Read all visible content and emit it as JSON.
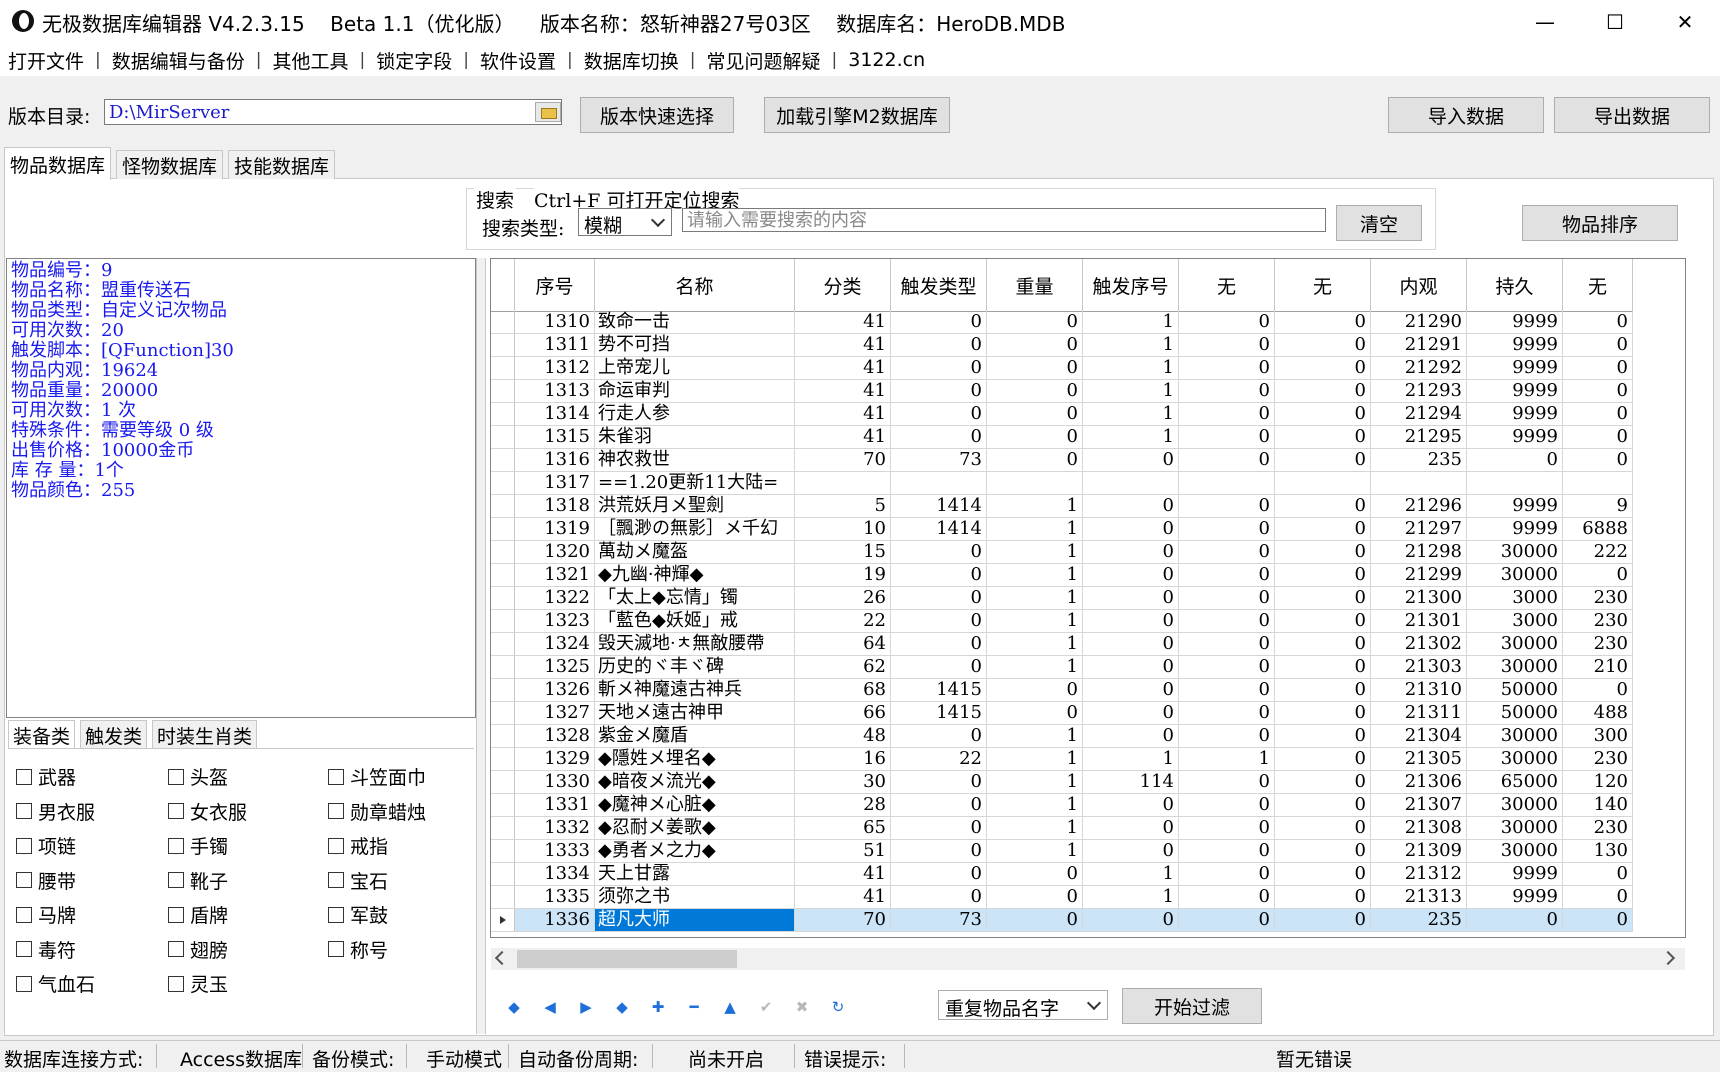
{
  "window": {
    "title": "无极数据库编辑器 V4.2.3.15    Beta 1.1（优化版）    版本名称：怒斩神器27号03区    数据库名：HeroDB.MDB",
    "minimize": "—",
    "maximize": "☐",
    "close": "✕"
  },
  "menu": [
    "打开文件",
    "数据编辑与备份",
    "其他工具",
    "锁定字段",
    "软件设置",
    "数据库切换",
    "常见问题解疑",
    "3122.cn"
  ],
  "menu_sep": "|",
  "toolbar": {
    "dir_label": "版本目录:",
    "dir_value": "D:\\MirServer",
    "quick_select": "版本快速选择",
    "load_m2": "加载引擎M2数据库",
    "import": "导入数据",
    "export": "导出数据"
  },
  "tabs": [
    "物品数据库",
    "怪物数据库",
    "技能数据库"
  ],
  "search": {
    "title": "搜索",
    "hint": "Ctrl+F 可打开定位搜索",
    "type_label": "搜索类型:",
    "type_value": "模糊",
    "placeholder": "请输入需要搜索的内容",
    "clear": "清空",
    "sort": "物品排序"
  },
  "info": [
    "物品编号：9",
    "物品名称：盟重传送石",
    "物品类型：自定义记次物品",
    "可用次数：20",
    "触发脚本：[QFunction]30",
    "物品内观：19624",
    "物品重量：20000",
    "可用次数：1 次",
    "特殊条件：需要等级 0 级",
    "出售价格：10000金币",
    "库 存 量：1个",
    "物品颜色：255"
  ],
  "subtabs": [
    "装备类",
    "触发类",
    "时装生肖类"
  ],
  "checkboxes": [
    [
      "武器",
      "头盔",
      "斗笠面巾"
    ],
    [
      "男衣服",
      "女衣服",
      "勋章蜡烛"
    ],
    [
      "项链",
      "手镯",
      "戒指"
    ],
    [
      "腰带",
      "靴子",
      "宝石"
    ],
    [
      "马牌",
      "盾牌",
      "军鼓"
    ],
    [
      "毒符",
      "翅膀",
      "称号"
    ],
    [
      "气血石",
      "灵玉"
    ]
  ],
  "grid": {
    "columns": [
      "序号",
      "名称",
      "分类",
      "触发类型",
      "重量",
      "触发序号",
      "无",
      "无",
      "内观",
      "持久",
      "无"
    ],
    "rows": [
      [
        "1310",
        "致命一击",
        "41",
        "0",
        "0",
        "1",
        "0",
        "0",
        "21290",
        "9999",
        "0"
      ],
      [
        "1311",
        "势不可挡",
        "41",
        "0",
        "0",
        "1",
        "0",
        "0",
        "21291",
        "9999",
        "0"
      ],
      [
        "1312",
        "上帝宠儿",
        "41",
        "0",
        "0",
        "1",
        "0",
        "0",
        "21292",
        "9999",
        "0"
      ],
      [
        "1313",
        "命运审判",
        "41",
        "0",
        "0",
        "1",
        "0",
        "0",
        "21293",
        "9999",
        "0"
      ],
      [
        "1314",
        "行走人参",
        "41",
        "0",
        "0",
        "1",
        "0",
        "0",
        "21294",
        "9999",
        "0"
      ],
      [
        "1315",
        "朱雀羽",
        "41",
        "0",
        "0",
        "1",
        "0",
        "0",
        "21295",
        "9999",
        "0"
      ],
      [
        "1316",
        "神农救世",
        "70",
        "73",
        "0",
        "0",
        "0",
        "0",
        "235",
        "0",
        "0"
      ],
      [
        "1317",
        "==1.20更新11大陆=",
        "",
        "",
        "",
        "",
        "",
        "",
        "",
        "",
        ""
      ],
      [
        "1318",
        "洪荒妖月メ聖劍",
        "5",
        "1414",
        "1",
        "0",
        "0",
        "0",
        "21296",
        "9999",
        "9"
      ],
      [
        "1319",
        "［飄渺の無影］メ千幻",
        "10",
        "1414",
        "1",
        "0",
        "0",
        "0",
        "21297",
        "9999",
        "6888"
      ],
      [
        "1320",
        "萬劫メ魔盔",
        "15",
        "0",
        "1",
        "0",
        "0",
        "0",
        "21298",
        "30000",
        "222"
      ],
      [
        "1321",
        "◆九幽·神輝◆",
        "19",
        "0",
        "1",
        "0",
        "0",
        "0",
        "21299",
        "30000",
        "0"
      ],
      [
        "1322",
        "「太上◆忘情」镯",
        "26",
        "0",
        "1",
        "0",
        "0",
        "0",
        "21300",
        "3000",
        "230"
      ],
      [
        "1323",
        "「藍色◆妖姬」戒",
        "22",
        "0",
        "1",
        "0",
        "0",
        "0",
        "21301",
        "3000",
        "230"
      ],
      [
        "1324",
        "毁天滅地·ㅊ無敵腰帶",
        "64",
        "0",
        "1",
        "0",
        "0",
        "0",
        "21302",
        "30000",
        "230"
      ],
      [
        "1325",
        "历史的ヾ丰ヾ碑",
        "62",
        "0",
        "1",
        "0",
        "0",
        "0",
        "21303",
        "30000",
        "210"
      ],
      [
        "1326",
        "斬メ神魔遠古神兵",
        "68",
        "1415",
        "0",
        "0",
        "0",
        "0",
        "21310",
        "50000",
        "0"
      ],
      [
        "1327",
        "天地メ遠古神甲",
        "66",
        "1415",
        "0",
        "0",
        "0",
        "0",
        "21311",
        "50000",
        "488"
      ],
      [
        "1328",
        "紫金メ魔盾",
        "48",
        "0",
        "1",
        "0",
        "0",
        "0",
        "21304",
        "30000",
        "300"
      ],
      [
        "1329",
        "◆隱姓メ埋名◆",
        "16",
        "22",
        "1",
        "1",
        "1",
        "0",
        "21305",
        "30000",
        "230"
      ],
      [
        "1330",
        "◆暗夜メ流光◆",
        "30",
        "0",
        "1",
        "114",
        "0",
        "0",
        "21306",
        "65000",
        "120"
      ],
      [
        "1331",
        "◆魔神メ心脏◆",
        "28",
        "0",
        "1",
        "0",
        "0",
        "0",
        "21307",
        "30000",
        "140"
      ],
      [
        "1332",
        "◆忍耐メ姜歌◆",
        "65",
        "0",
        "1",
        "0",
        "0",
        "0",
        "21308",
        "30000",
        "230"
      ],
      [
        "1333",
        "◆勇者メ之力◆",
        "51",
        "0",
        "1",
        "0",
        "0",
        "0",
        "21309",
        "30000",
        "130"
      ],
      [
        "1334",
        "天上甘露",
        "41",
        "0",
        "0",
        "1",
        "0",
        "0",
        "21312",
        "9999",
        "0"
      ],
      [
        "1335",
        "须弥之书",
        "41",
        "0",
        "0",
        "1",
        "0",
        "0",
        "21313",
        "9999",
        "0"
      ],
      [
        "1336",
        "超凡大师",
        "70",
        "73",
        "0",
        "0",
        "0",
        "0",
        "235",
        "0",
        "0"
      ]
    ],
    "selected_row": 26
  },
  "navigator": [
    {
      "icon": "first-record-icon",
      "glyph": "◆"
    },
    {
      "icon": "prior-record-icon",
      "glyph": "◀"
    },
    {
      "icon": "next-record-icon",
      "glyph": "▶"
    },
    {
      "icon": "last-record-icon",
      "glyph": "◆"
    },
    {
      "icon": "insert-record-icon",
      "glyph": "✚"
    },
    {
      "icon": "delete-record-icon",
      "glyph": "━"
    },
    {
      "icon": "edit-record-icon",
      "glyph": "▲"
    },
    {
      "icon": "post-record-icon",
      "glyph": "✔"
    },
    {
      "icon": "cancel-edit-icon",
      "glyph": "✖"
    },
    {
      "icon": "refresh-icon",
      "glyph": "↻"
    }
  ],
  "filter": {
    "dup_value": "重复物品名字",
    "start": "开始过滤"
  },
  "status": {
    "conn_label": "数据库连接方式:",
    "conn_value": "Access数据库",
    "backup_label": "备份模式:",
    "backup_value": "手动模式",
    "auto_label": "自动备份周期:",
    "auto_value": "尚未开启",
    "error_label": "错误提示:",
    "error_value": "暂无错误"
  },
  "colors": {
    "info_text": "#1a1aee",
    "selection": "#0078d7",
    "selection_row": "#cce4f7"
  }
}
